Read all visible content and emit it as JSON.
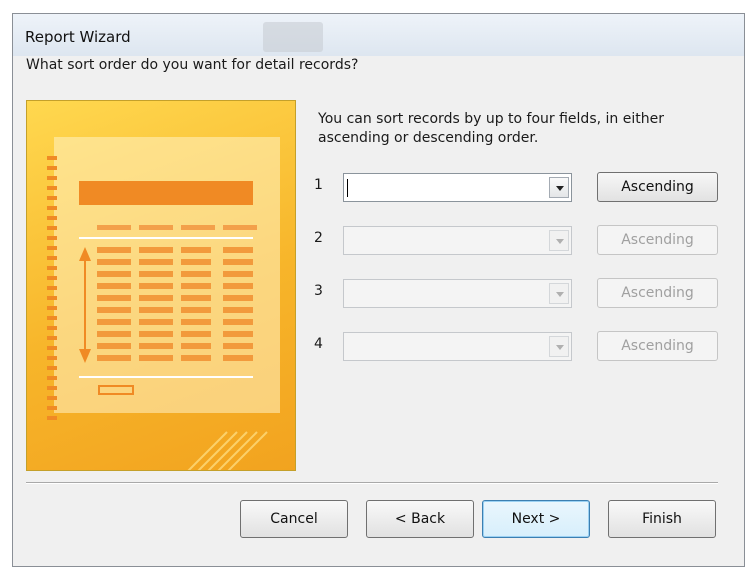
{
  "window": {
    "title": "Report Wizard"
  },
  "header": {
    "question": "What sort order do you want for detail records?"
  },
  "description": "You can sort records by up to four fields, in either ascending or descending order.",
  "sort_rows": [
    {
      "number": "1",
      "field_value": "",
      "order": "Ascending",
      "enabled": true
    },
    {
      "number": "2",
      "field_value": "",
      "order": "Ascending",
      "enabled": false
    },
    {
      "number": "3",
      "field_value": "",
      "order": "Ascending",
      "enabled": false
    },
    {
      "number": "4",
      "field_value": "",
      "order": "Ascending",
      "enabled": false
    }
  ],
  "buttons": {
    "cancel": "Cancel",
    "back": "< Back",
    "next": "Next >",
    "finish": "Finish"
  },
  "colors": {
    "picture_gold": "#f7b52a",
    "report_header_bar": "#f08a24",
    "default_button_border": "#3c7fb1"
  }
}
